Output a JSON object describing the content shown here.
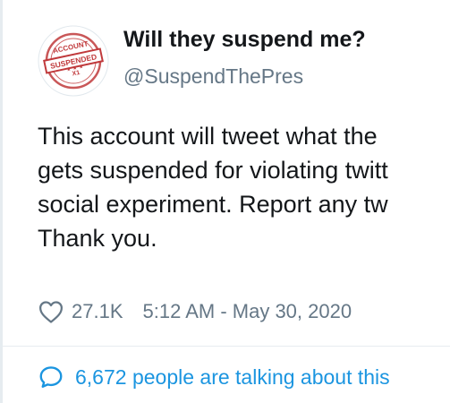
{
  "profile": {
    "display_name": "Will they suspend me?",
    "handle": "@SuspendThePres",
    "avatar_badge": {
      "line1": "ACCOUNT",
      "line2": "SUSPENDED",
      "line3": "X1"
    }
  },
  "tweet": {
    "lines": [
      "This account will tweet what the",
      "gets suspended for violating twitt",
      "social experiment. Report any tw",
      "Thank you."
    ],
    "likes": "27.1K",
    "timestamp": "5:12 AM - May 30, 2020"
  },
  "footer": {
    "talking_label": "6,672 people are talking about this"
  },
  "icons": {
    "heart": "heart-icon",
    "conversation": "speech-bubble-icon"
  },
  "colors": {
    "text": "#14171a",
    "secondary": "#657786",
    "link": "#1b95e0",
    "stamp_red": "#c0393b"
  }
}
